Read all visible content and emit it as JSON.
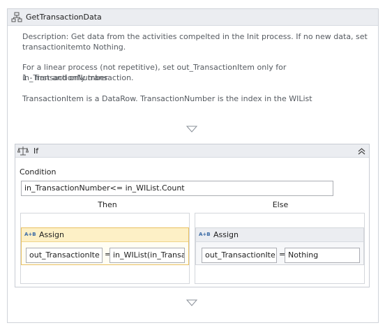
{
  "sequence": {
    "title": "GetTransactionData",
    "description": [
      "Description: Get data from the activities compelted in the Init process. If no new data, set",
      "transactionitemto Nothing.",
      "For a linear process (not repetitive), set out_TransactionItem only for in_TransactionNumber",
      "1 - first and only transaction.",
      "TransactionItem is a DataRow. TransactionNumber is the index in the WIList"
    ]
  },
  "if_activity": {
    "title": "If",
    "condition_label": "Condition",
    "condition_value": "in_TransactionNumber<= in_WIList.Count",
    "then_label": "Then",
    "else_label": "Else"
  },
  "then_assign": {
    "badge": "A+B",
    "title": "Assign",
    "to_value": "out_TransactionIte",
    "equals": "=",
    "value": "in_WIList(in_Transa",
    "selected": true
  },
  "else_assign": {
    "badge": "A+B",
    "title": "Assign",
    "to_value": "out_TransactionIte",
    "equals": "=",
    "value": "Nothing",
    "selected": false
  },
  "colors": {
    "header_bg": "#ebedf1",
    "selected_header_bg": "#fdf0c6",
    "selected_border": "#e8c062",
    "border": "#cfd3d9"
  },
  "icons": {
    "sequence": "sequence-activity-icon",
    "if": "if-balance-icon",
    "collapse": "collapse-chevron-icon",
    "drop_arrow": "drop-target-arrow-icon"
  }
}
